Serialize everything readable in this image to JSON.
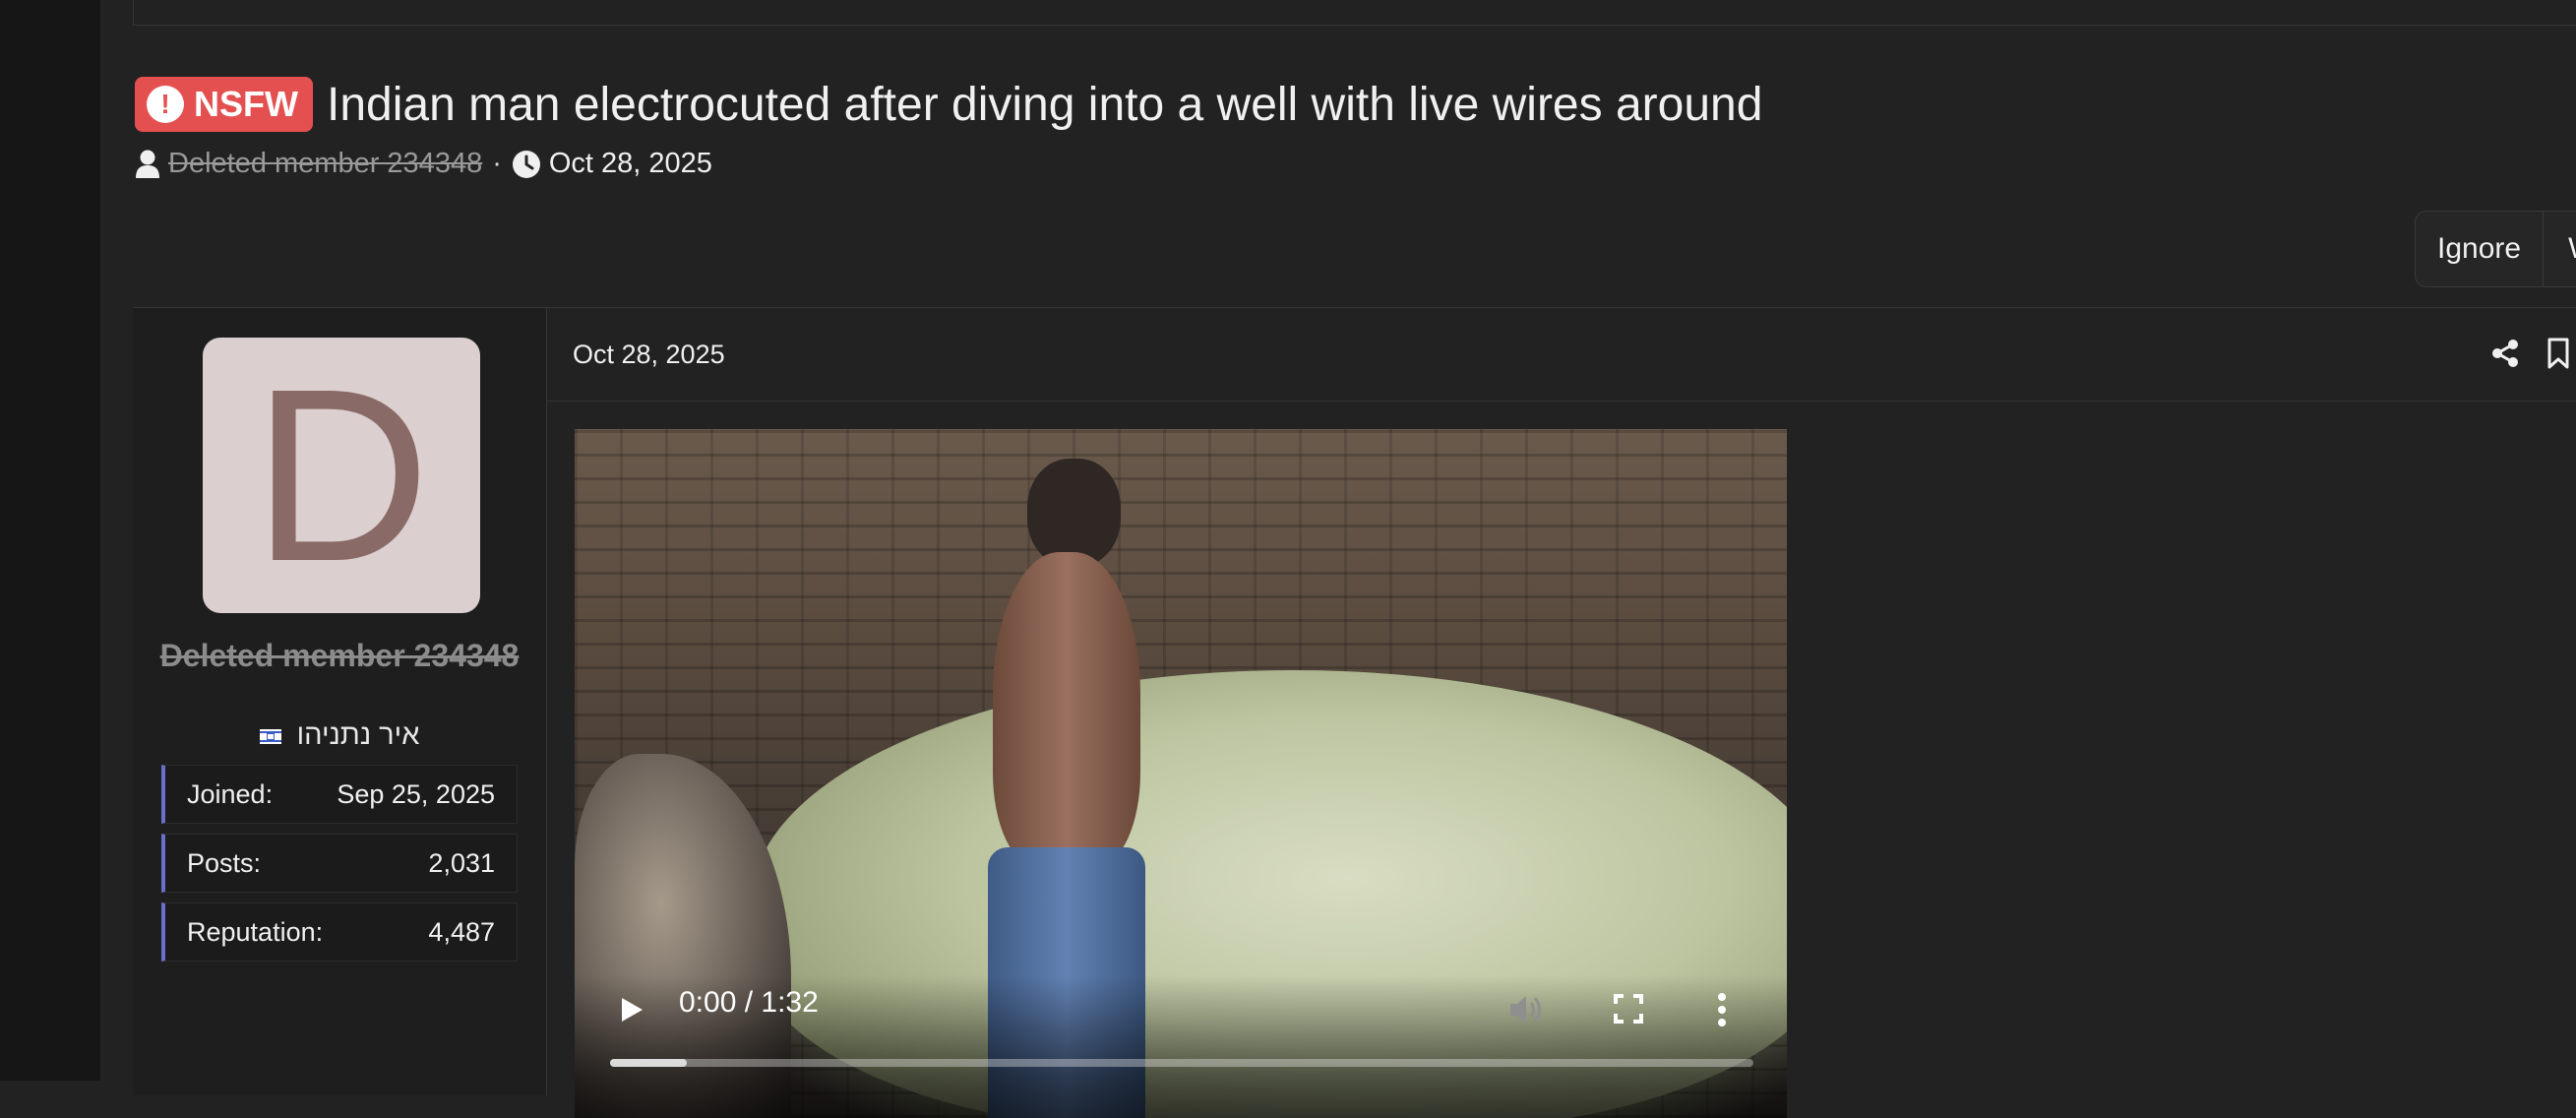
{
  "thread": {
    "badge": "NSFW",
    "title": "Indian man electrocuted after diving into a well with live wires around",
    "author": "Deleted member 234348",
    "separator": "·",
    "date": "Oct 28, 2025"
  },
  "actions": {
    "ignore": "Ignore",
    "watch": "W"
  },
  "post": {
    "date": "Oct 28, 2025",
    "author": {
      "avatar_letter": "D",
      "name": "Deleted member 234348",
      "title": "איר נתניהו",
      "stats": [
        {
          "label": "Joined:",
          "value": "Sep 25, 2025"
        },
        {
          "label": "Posts:",
          "value": "2,031"
        },
        {
          "label": "Reputation:",
          "value": "4,487"
        }
      ]
    },
    "video": {
      "time": "0:00 / 1:32",
      "progress_fraction": 0.067
    }
  },
  "colors": {
    "nsfw_badge": "#e45050",
    "avatar_bg": "#dbcfcf",
    "avatar_letter": "#8a6a66",
    "stat_accent": "#6a6fc8"
  }
}
